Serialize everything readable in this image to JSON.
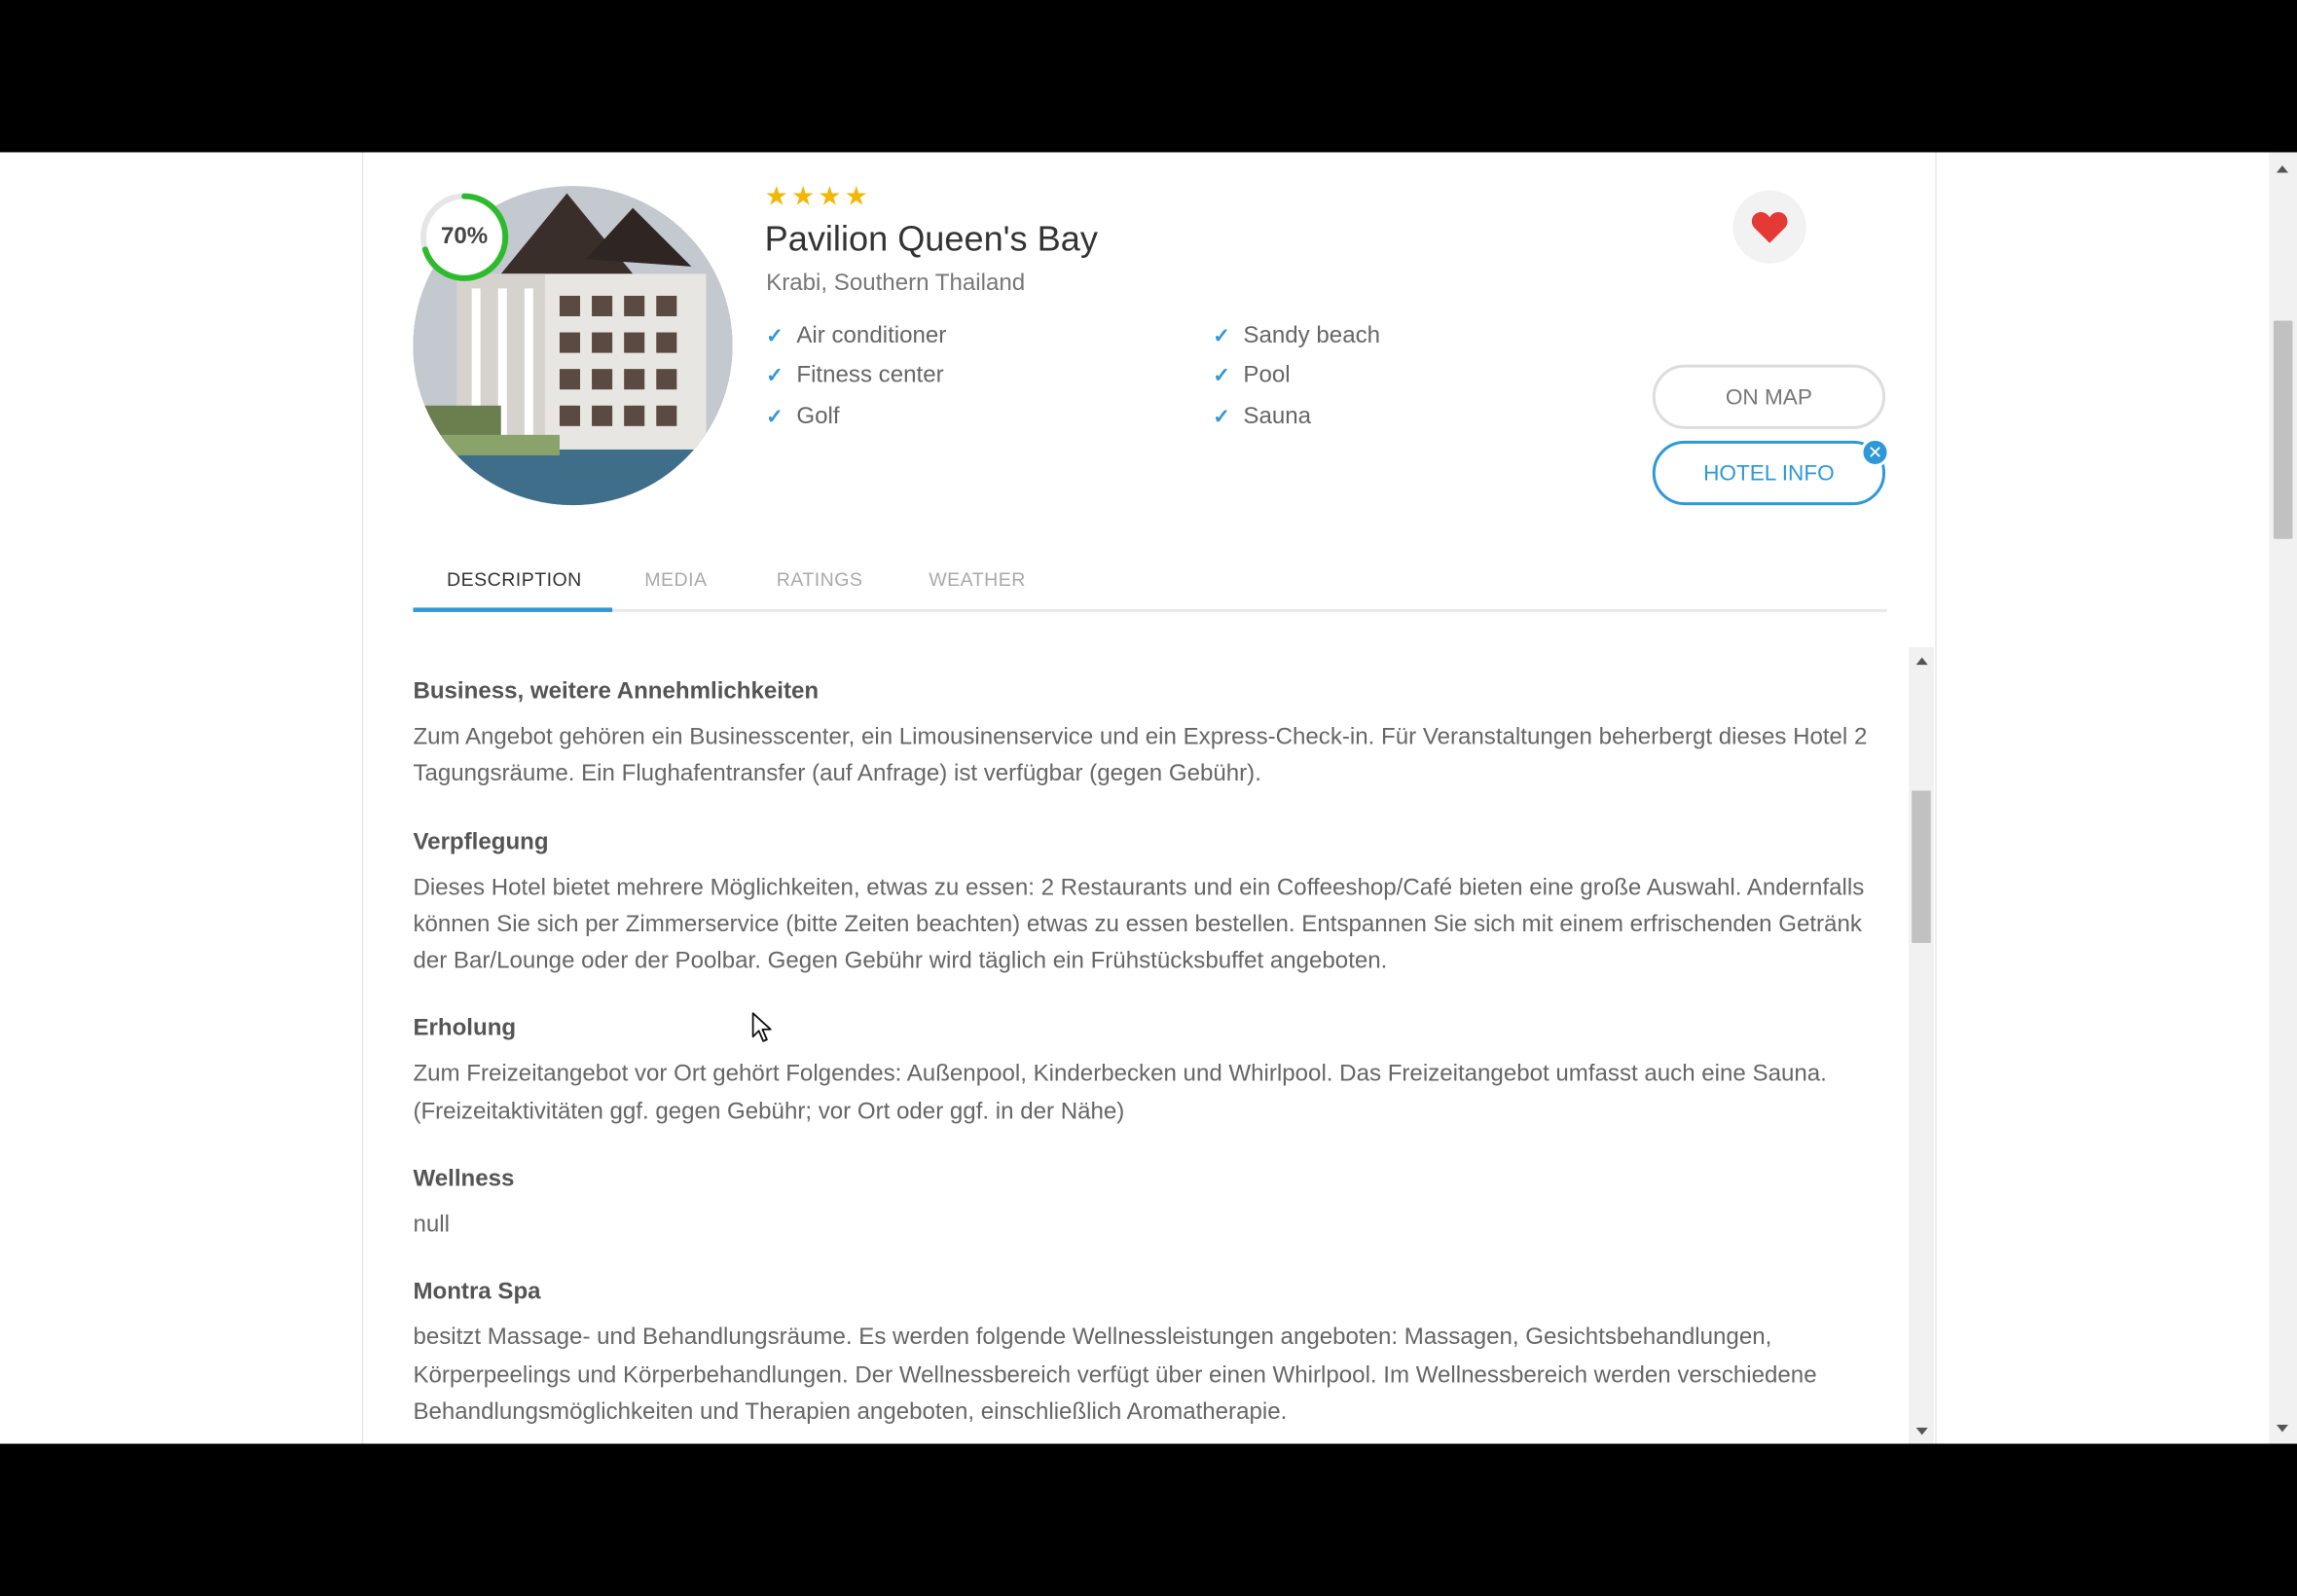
{
  "hotel": {
    "score": "70%",
    "score_fraction": 0.7,
    "stars": 4,
    "star_glyph": "★",
    "name": "Pavilion Queen's Bay",
    "location": "Krabi, Southern Thailand",
    "amenities": [
      "Air conditioner",
      "Fitness center",
      "Golf",
      "Sandy beach",
      "Pool",
      "Sauna"
    ],
    "check_glyph": "✓"
  },
  "actions": {
    "on_map": "ON MAP",
    "hotel_info": "HOTEL INFO",
    "close_glyph": "✕"
  },
  "tabs": [
    "DESCRIPTION",
    "MEDIA",
    "RATINGS",
    "WEATHER"
  ],
  "active_tab": "DESCRIPTION",
  "sections": [
    {
      "title": "Business, weitere Annehmlichkeiten",
      "body": "Zum Angebot gehören ein Businesscenter, ein Limousinenservice und ein Express-Check-in. Für Veranstaltungen beherbergt dieses Hotel 2 Tagungsräume. Ein Flughafentransfer (auf Anfrage) ist verfügbar (gegen Gebühr)."
    },
    {
      "title": "Verpflegung",
      "body": "Dieses Hotel bietet mehrere Möglichkeiten, etwas zu essen: 2 Restaurants und ein Coffeeshop/Café bieten eine große Auswahl. Andernfalls können Sie sich per Zimmerservice (bitte Zeiten beachten) etwas zu essen bestellen. Entspannen Sie sich mit einem erfrischenden Getränk der Bar/Lounge oder der Poolbar. Gegen Gebühr wird täglich ein Frühstücksbuffet angeboten."
    },
    {
      "title": "Erholung",
      "body": "Zum Freizeitangebot vor Ort gehört Folgendes: Außenpool, Kinderbecken und Whirlpool. Das Freizeitangebot umfasst auch eine Sauna. (Freizeitaktivitäten ggf. gegen Gebühr; vor Ort oder ggf. in der Nähe)"
    },
    {
      "title": "Wellness",
      "body": "null"
    },
    {
      "title": "Montra Spa",
      "body": "besitzt Massage- und Behandlungsräume. Es werden folgende Wellnessleistungen angeboten: Massagen, Gesichtsbehandlungen, Körperpeelings und Körperbehandlungen. Der Wellnessbereich verfügt über einen Whirlpool. Im Wellnessbereich werden verschiedene Behandlungsmöglichkeiten und Therapien angeboten, einschließlich Aromatherapie."
    }
  ],
  "colors": {
    "accent": "#2f98d6",
    "score_ring": "#2dbb2d",
    "star": "#f2b705",
    "heart": "#e53935"
  },
  "icons": {
    "favorite": "heart-icon",
    "check": "check-icon",
    "close": "close-icon",
    "cursor": "mouse-cursor-icon"
  }
}
